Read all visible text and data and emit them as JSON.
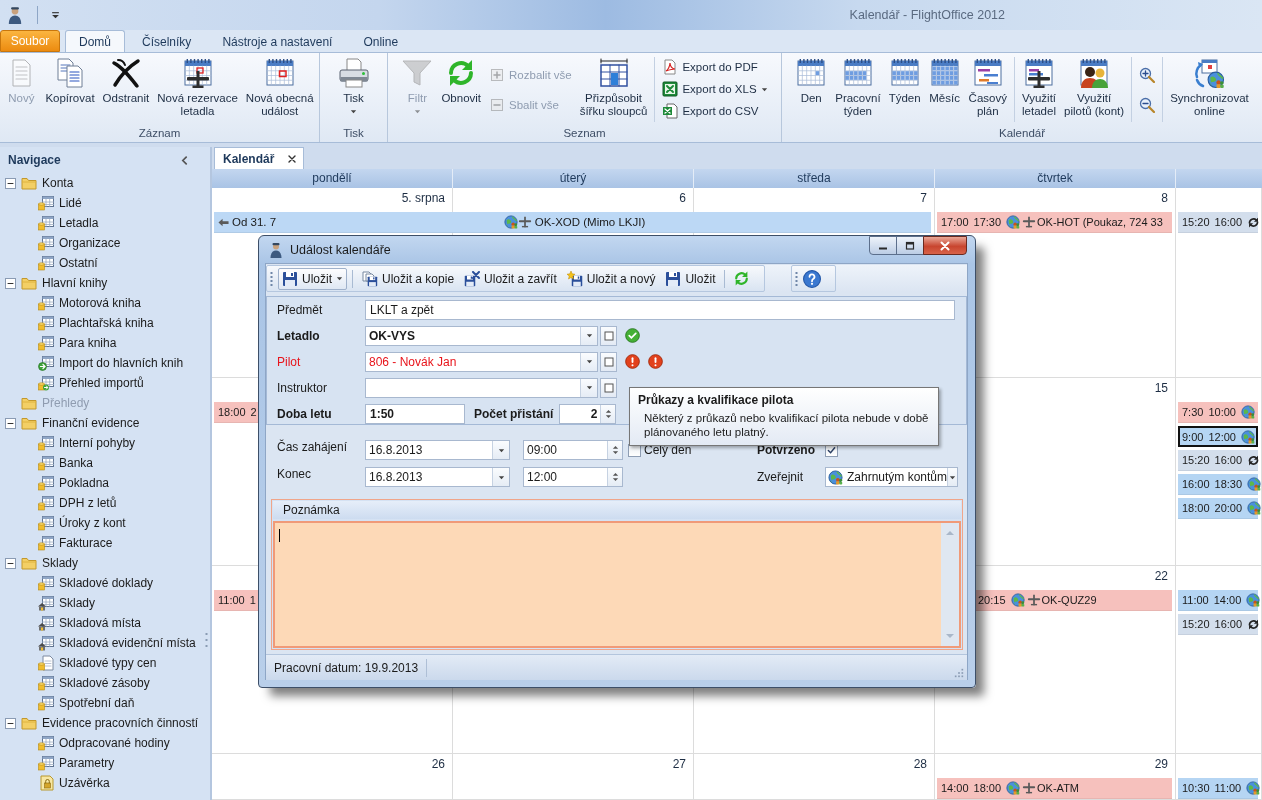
{
  "window": {
    "title": "Kalendář - FlightOffice 2012"
  },
  "ribbon": {
    "file_button": "Soubor",
    "tabs": [
      {
        "label": "Domů",
        "selected": true
      },
      {
        "label": "Číselníky",
        "selected": false
      },
      {
        "label": "Nástroje a nastavení",
        "selected": false
      },
      {
        "label": "Online",
        "selected": false
      }
    ],
    "groups": [
      {
        "label": "Záznam",
        "sections": [
          [
            {
              "kind": "large",
              "label": "Nový",
              "disabled": true,
              "dropdown": false
            },
            {
              "kind": "large",
              "label": "Kopírovat",
              "disabled": false,
              "dropdown": false
            },
            {
              "kind": "large",
              "label": "Odstranit",
              "disabled": false,
              "dropdown": false
            },
            {
              "kind": "large",
              "label": "Nová rezervace\nletadla",
              "disabled": false,
              "dropdown": false
            },
            {
              "kind": "large",
              "label": "Nová obecná\nudálost",
              "disabled": false,
              "dropdown": false
            }
          ]
        ]
      },
      {
        "label": "Tisk",
        "sections": [
          [
            {
              "kind": "large",
              "label": "Tisk",
              "disabled": false,
              "dropdown": true
            }
          ]
        ]
      },
      {
        "label": "Seznam",
        "sections": [
          [
            {
              "kind": "large",
              "label": "Filtr",
              "disabled": true,
              "dropdown": true
            },
            {
              "kind": "large",
              "label": "Obnovit",
              "disabled": false,
              "dropdown": false
            },
            {
              "kind": "stack",
              "items": [
                {
                  "label": "Rozbalit vše",
                  "disabled": true,
                  "dropdown": false
                },
                {
                  "label": "Sbalit vše",
                  "disabled": true,
                  "dropdown": false
                }
              ]
            },
            {
              "kind": "large",
              "label": "Přizpůsobit\nšířku sloupců",
              "disabled": false,
              "dropdown": false
            }
          ],
          [
            {
              "kind": "stack",
              "items": [
                {
                  "label": "Export do PDF",
                  "disabled": false,
                  "dropdown": false
                },
                {
                  "label": "Export do XLS",
                  "disabled": false,
                  "dropdown": true
                },
                {
                  "label": "Export do CSV",
                  "disabled": false,
                  "dropdown": false
                }
              ]
            }
          ]
        ]
      },
      {
        "label": "Kalendář",
        "sections": [
          [
            {
              "kind": "large",
              "label": "Den",
              "disabled": false,
              "dropdown": false
            },
            {
              "kind": "large",
              "label": "Pracovní\ntýden",
              "disabled": false,
              "dropdown": false
            },
            {
              "kind": "large",
              "label": "Týden",
              "disabled": false,
              "dropdown": false
            },
            {
              "kind": "large",
              "label": "Měsíc",
              "disabled": false,
              "dropdown": false
            },
            {
              "kind": "large",
              "label": "Časový\nplán",
              "disabled": false,
              "dropdown": false
            }
          ],
          [
            {
              "kind": "large",
              "label": "Využití\nletadel",
              "disabled": false,
              "dropdown": false
            },
            {
              "kind": "large",
              "label": "Využití\npilotů (kont)",
              "disabled": false,
              "dropdown": false
            }
          ],
          [
            {
              "kind": "stack",
              "items": [
                {
                  "disabled": false,
                  "dropdown": false
                },
                {
                  "disabled": false,
                  "dropdown": false
                }
              ]
            }
          ],
          [
            {
              "kind": "large",
              "label": "Synchronizovat\nonline",
              "disabled": false,
              "dropdown": false
            }
          ]
        ]
      }
    ]
  },
  "navigation": {
    "title": "Navigace",
    "tree": [
      {
        "label": "Konta",
        "expanded": true,
        "disabled": false,
        "children": [
          {
            "label": "Lidé",
            "kind": "table"
          },
          {
            "label": "Letadla",
            "kind": "table"
          },
          {
            "label": "Organizace",
            "kind": "table"
          },
          {
            "label": "Ostatní",
            "kind": "table"
          }
        ]
      },
      {
        "label": "Hlavní knihy",
        "expanded": true,
        "disabled": false,
        "children": [
          {
            "label": "Motorová kniha",
            "kind": "table"
          },
          {
            "label": "Plachtařská kniha",
            "kind": "table"
          },
          {
            "label": "Para kniha",
            "kind": "table"
          },
          {
            "label": "Import do hlavních knih",
            "kind": "import"
          },
          {
            "label": "Přehled importů",
            "kind": "log"
          }
        ]
      },
      {
        "label": "Přehledy",
        "disabled": true
      },
      {
        "label": "Finanční evidence",
        "expanded": true,
        "disabled": false,
        "children": [
          {
            "label": "Interní pohyby",
            "kind": "table"
          },
          {
            "label": "Banka",
            "kind": "table"
          },
          {
            "label": "Pokladna",
            "kind": "table"
          },
          {
            "label": "DPH z letů",
            "kind": "table"
          },
          {
            "label": "Úroky z kont",
            "kind": "table"
          },
          {
            "label": "Fakturace",
            "kind": "table"
          }
        ]
      },
      {
        "label": "Sklady",
        "expanded": true,
        "disabled": false,
        "children": [
          {
            "label": "Skladové doklady",
            "kind": "table"
          },
          {
            "label": "Sklady",
            "kind": "store"
          },
          {
            "label": "Skladová místa",
            "kind": "store"
          },
          {
            "label": "Skladová evidenční místa",
            "kind": "store"
          },
          {
            "label": "Skladové typy cen",
            "kind": "document"
          },
          {
            "label": "Skladové zásoby",
            "kind": "table"
          },
          {
            "label": "Spotřební daň",
            "kind": "table"
          }
        ]
      },
      {
        "label": "Evidence pracovních činností",
        "expanded": true,
        "disabled": false,
        "children": [
          {
            "label": "Odpracované hodiny",
            "kind": "table"
          },
          {
            "label": "Parametry",
            "kind": "table"
          },
          {
            "label": "Uzávěrka",
            "kind": "lock"
          }
        ]
      }
    ]
  },
  "document_tab": {
    "label": "Kalendář"
  },
  "calendar": {
    "days": [
      "pondělí",
      "úterý",
      "středa",
      "čtvrtek"
    ],
    "weeks": [
      {
        "banner": {
          "from": "Od 31. 7",
          "title": "OK-XOD (Mimo LKJI)",
          "color": "#bcd8f5"
        },
        "cells": [
          {
            "date": "5. srpna"
          },
          {
            "date": "6"
          },
          {
            "date": "7"
          },
          {
            "date": "8",
            "events": [
              {
                "kind": "flight",
                "start": "17:00",
                "end": "17:30",
                "title": "OK-HOT (Poukaz, 724 33",
                "color": "#f6c1bd",
                "selected": false
              }
            ]
          },
          {
            "events": [
              {
                "kind": "sync",
                "start": "15:20",
                "end": "16:00",
                "color": "#d3deec",
                "selected": false
              }
            ]
          }
        ]
      },
      {
        "cells": [
          {
            "events": [
              {
                "kind": "plain",
                "start": "18:00",
                "end": "2",
                "color": "#f6c1bd",
                "selected": false
              }
            ]
          },
          {},
          {},
          {
            "date": "15"
          },
          {
            "events": [
              {
                "kind": "online",
                "start": "7:30",
                "end": "10:00",
                "color": "#f6c1bd",
                "selected": false
              },
              {
                "kind": "online",
                "start": "9:00",
                "end": "12:00",
                "color": "#b5d5f3",
                "selected": true
              },
              {
                "kind": "sync",
                "start": "15:20",
                "end": "16:00",
                "color": "#d3deec",
                "selected": false
              },
              {
                "kind": "online",
                "start": "16:00",
                "end": "18:30",
                "color": "#b5d5f3",
                "selected": false
              },
              {
                "kind": "online",
                "start": "18:00",
                "end": "20:00",
                "color": "#b5d5f3",
                "selected": false
              }
            ]
          }
        ]
      },
      {
        "cells": [
          {
            "events": [
              {
                "kind": "plain",
                "start": "11:00",
                "end": "1",
                "color": "#f6c1bd",
                "selected": false
              }
            ]
          },
          {},
          {},
          {
            "date": "22",
            "events": [
              {
                "kind": "flight",
                "end": "20:15",
                "title": "OK-QUZ29",
                "color": "#f6c1bd",
                "selected": false
              }
            ]
          },
          {
            "events": [
              {
                "kind": "online",
                "start": "11:00",
                "end": "14:00",
                "color": "#b5d5f3",
                "selected": false
              },
              {
                "kind": "sync",
                "start": "15:20",
                "end": "16:00",
                "color": "#d3deec",
                "selected": false
              }
            ]
          }
        ]
      },
      {
        "cells": [
          {
            "date": "26"
          },
          {
            "date": "27"
          },
          {
            "date": "28"
          },
          {
            "date": "29",
            "events": [
              {
                "kind": "flight",
                "start": "14:00",
                "end": "18:00",
                "title": "OK-ATM",
                "color": "#f6c1bd",
                "selected": false
              }
            ]
          },
          {
            "events": [
              {
                "kind": "online",
                "start": "10:30",
                "end": "11:00",
                "color": "#b5d5f3",
                "selected": false
              }
            ]
          }
        ]
      }
    ]
  },
  "dialog": {
    "title": "Událost kalendáře",
    "toolbar": [
      {
        "kind": "split",
        "label": "Uložit"
      },
      {
        "kind": "button",
        "label": "Uložit a kopie"
      },
      {
        "kind": "button",
        "label": "Uložit a zavřít"
      },
      {
        "kind": "button",
        "label": "Uložit a nový"
      },
      {
        "kind": "button",
        "label": "Uložit"
      },
      {
        "kind": "refresh"
      },
      {
        "kind": "help"
      }
    ],
    "form": {
      "subject": {
        "label": "Předmět",
        "value": "LKLT a zpět"
      },
      "lookups": [
        {
          "label": "Letadlo",
          "value": "OK-VYS",
          "required": true,
          "invalid": false,
          "indicators": [
            {
              "kind": "ok"
            }
          ]
        },
        {
          "label": "Pilot",
          "value": "806 - Novák Jan",
          "required": false,
          "invalid": true,
          "indicators": [
            {
              "kind": "error"
            },
            {
              "kind": "error"
            }
          ]
        },
        {
          "label": "Instruktor",
          "required": false,
          "invalid": false
        }
      ],
      "flight_time": {
        "label": "Doba letu",
        "value": "1:50"
      },
      "landings": {
        "label": "Počet přistání",
        "value": "2"
      }
    },
    "tooltip": {
      "title": "Průkazy a kvalifikace pilota",
      "text": "Některý z průkazů nebo kvalifikací pilota nebude v době\nplánovaného letu platný."
    },
    "schedule": {
      "start": {
        "label": "Čas zahájení",
        "date": "16.8.2013",
        "time": "09:00"
      },
      "end": {
        "label": "Konec",
        "date": "16.8.2013",
        "time": "12:00"
      },
      "all_day": {
        "label": "Celý den",
        "checked": false
      },
      "confirmed": {
        "label": "Potvrzeno",
        "checked": true
      },
      "publish": {
        "label": "Zveřejnit",
        "value": "Zahrnutým kontům"
      }
    },
    "note": {
      "label": "Poznámka"
    },
    "status_bar": {
      "text": "Pracovní datum: 19.9.2013"
    }
  }
}
